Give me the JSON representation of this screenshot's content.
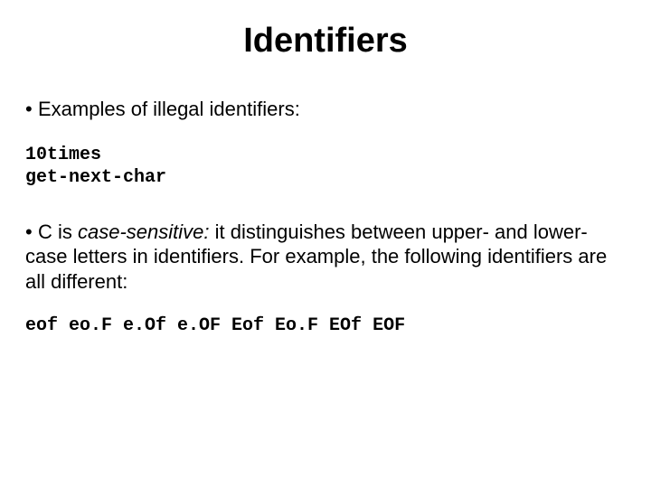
{
  "title": "Identifiers",
  "bullets": {
    "b1_prefix": "• ",
    "b1_text": "Examples of illegal identifiers:",
    "code1_line1": "10times",
    "code1_line2": "get-next-char",
    "b2_prefix": "• ",
    "b2_lead": "C is ",
    "b2_emph": "case-sensitive:",
    "b2_rest": " it distinguishes between upper- and lower-case letters in identifiers. For example, the following identifiers are all different:",
    "code2": "eof eo.F e.Of e.OF Eof Eo.F EOf EOF"
  }
}
